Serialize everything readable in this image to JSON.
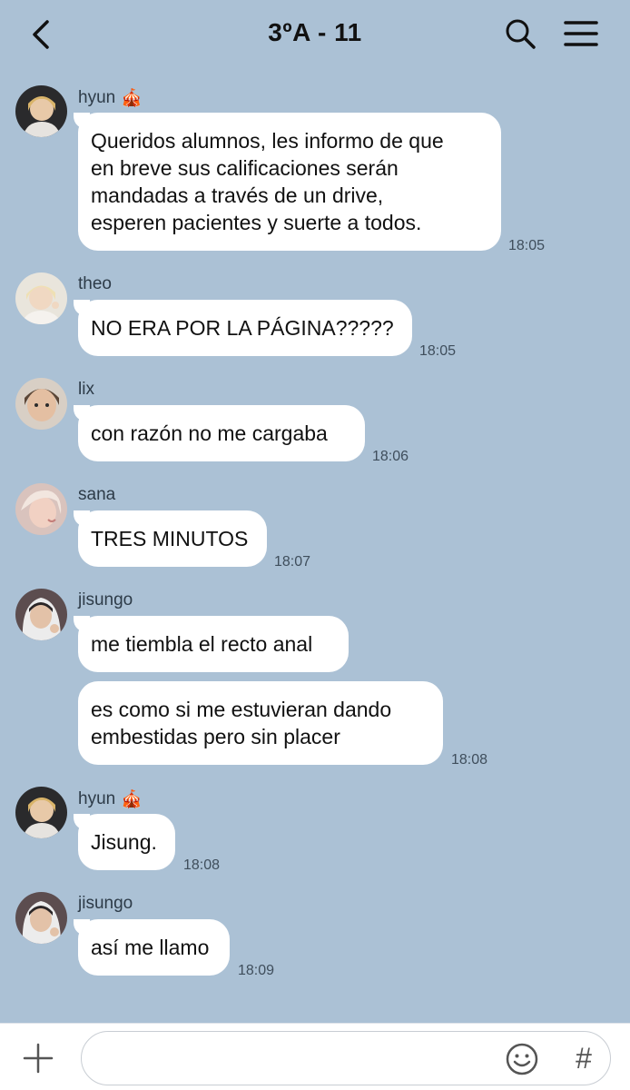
{
  "header": {
    "title": "3ºA - 11",
    "back_icon": "chevron-left-icon",
    "search_icon": "search-icon",
    "menu_icon": "hamburger-menu-icon"
  },
  "messages": [
    {
      "sender": "hyun",
      "badge": "🎪",
      "text": "Queridos alumnos, les informo de que\nen breve sus calificaciones serán\nmandadas a través de un drive,\nesperen pacientes y suerte a todos.",
      "time": "18:05"
    },
    {
      "sender": "theo",
      "text": "NO ERA POR LA PÁGINA?????",
      "time": "18:05"
    },
    {
      "sender": "lix",
      "text": "con razón no me cargaba",
      "time": "18:06"
    },
    {
      "sender": "sana",
      "text": "TRES MINUTOS",
      "time": "18:07"
    },
    {
      "sender": "jisungo",
      "text": "me tiembla el recto anal",
      "text2": "es como si me estuvieran dando\nembestidas pero sin placer",
      "time": "18:08"
    },
    {
      "sender": "hyun",
      "badge": "🎪",
      "text": "Jisung.",
      "time": "18:08"
    },
    {
      "sender": "jisungo",
      "text": "así me llamo",
      "time": "18:09"
    }
  ],
  "footer": {
    "plus_icon": "plus-icon",
    "input_placeholder": "",
    "emoji_icon": "emoji-icon",
    "hash_label": "#"
  }
}
